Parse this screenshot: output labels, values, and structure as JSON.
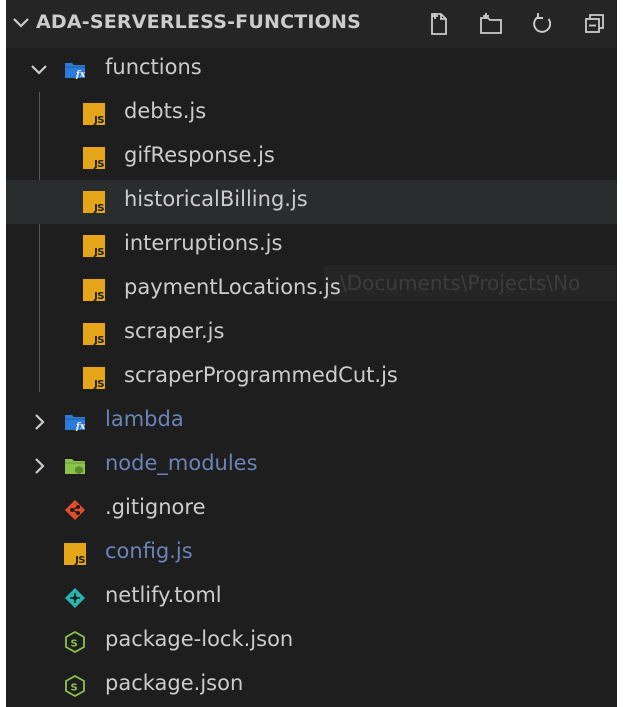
{
  "explorer": {
    "title": "ADA-SERVERLESS-FUNCTIONS",
    "actions": [
      {
        "name": "new-file",
        "icon": "new-file-icon"
      },
      {
        "name": "new-folder",
        "icon": "new-folder-icon"
      },
      {
        "name": "refresh",
        "icon": "refresh-icon"
      },
      {
        "name": "collapse-all",
        "icon": "collapse-all-icon"
      }
    ],
    "tree": [
      {
        "label": "functions",
        "type": "folder",
        "expanded": true
      },
      {
        "label": "debts.js",
        "type": "js"
      },
      {
        "label": "gifResponse.js",
        "type": "js"
      },
      {
        "label": "historicalBilling.js",
        "type": "js",
        "selected": true
      },
      {
        "label": "interruptions.js",
        "type": "js"
      },
      {
        "label": "paymentLocations.js",
        "type": "js"
      },
      {
        "label": "scraper.js",
        "type": "js"
      },
      {
        "label": "scraperProgrammedCut.js",
        "type": "js"
      },
      {
        "label": "lambda",
        "type": "folder",
        "expanded": false
      },
      {
        "label": "node_modules",
        "type": "folder",
        "expanded": false
      },
      {
        "label": ".gitignore",
        "type": "git"
      },
      {
        "label": "config.js",
        "type": "js"
      },
      {
        "label": "netlify.toml",
        "type": "netlify"
      },
      {
        "label": "package-lock.json",
        "type": "node"
      },
      {
        "label": "package.json",
        "type": "node"
      }
    ],
    "tooltip": "\\Documents\\Projects\\No"
  },
  "colors": {
    "background": "#1e1e1e",
    "header": "#252526",
    "selected": "#2a2d2e",
    "text": "#cccccc",
    "dim_text": "#6a83b8",
    "js_badge": "#e5a619",
    "folder_blue": "#2f7ad8",
    "node_modules_green": "#8bc34a",
    "git_orange": "#e44d26",
    "netlify_teal": "#2bb5b1",
    "node_green": "#8bc34a"
  }
}
